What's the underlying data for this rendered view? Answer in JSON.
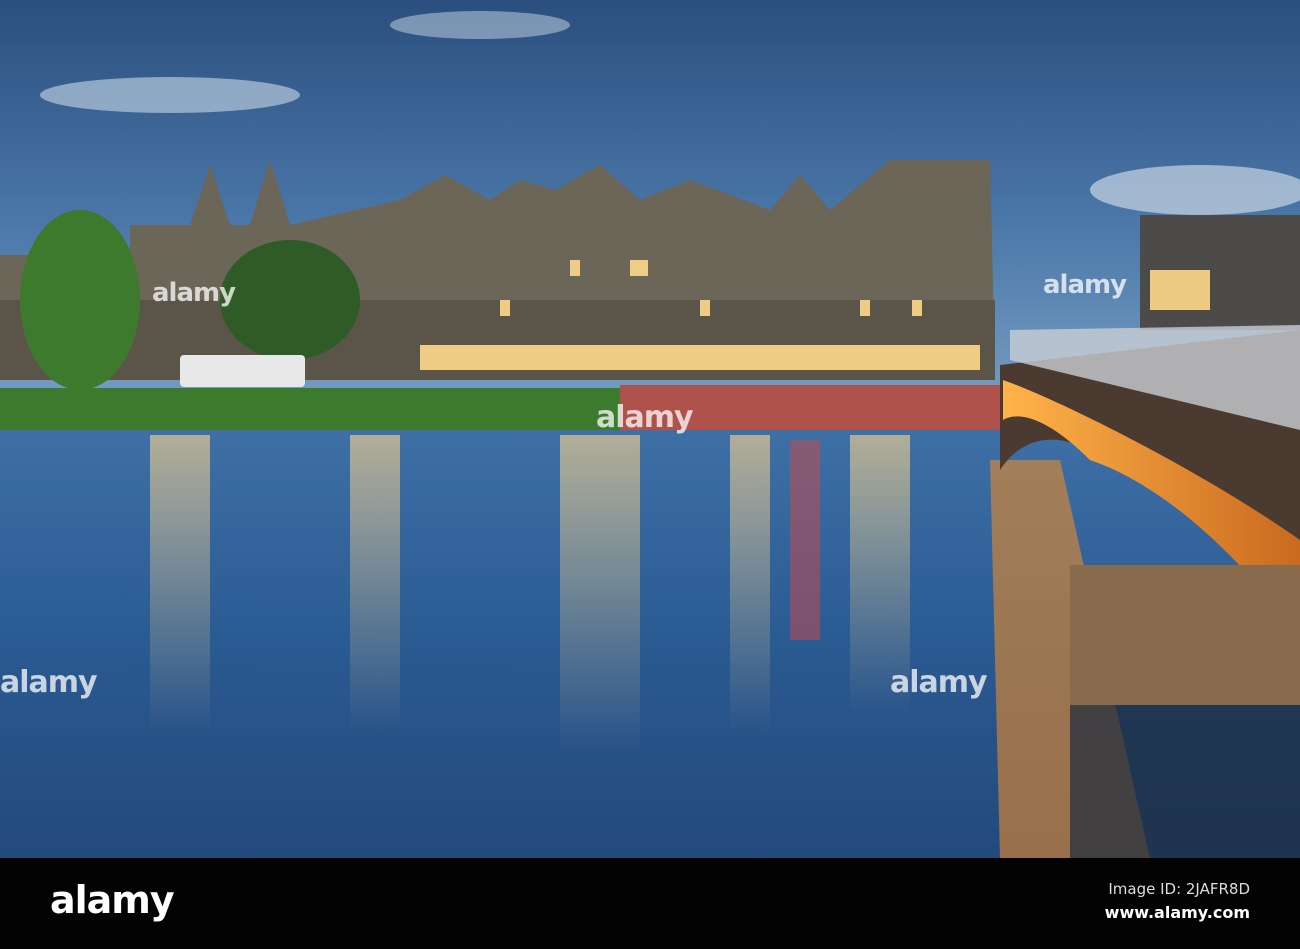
{
  "watermark": "alamy",
  "footer": {
    "logo": "alamy",
    "image_id": "Image ID: 2JAFR8D",
    "url": "www.alamy.com"
  }
}
